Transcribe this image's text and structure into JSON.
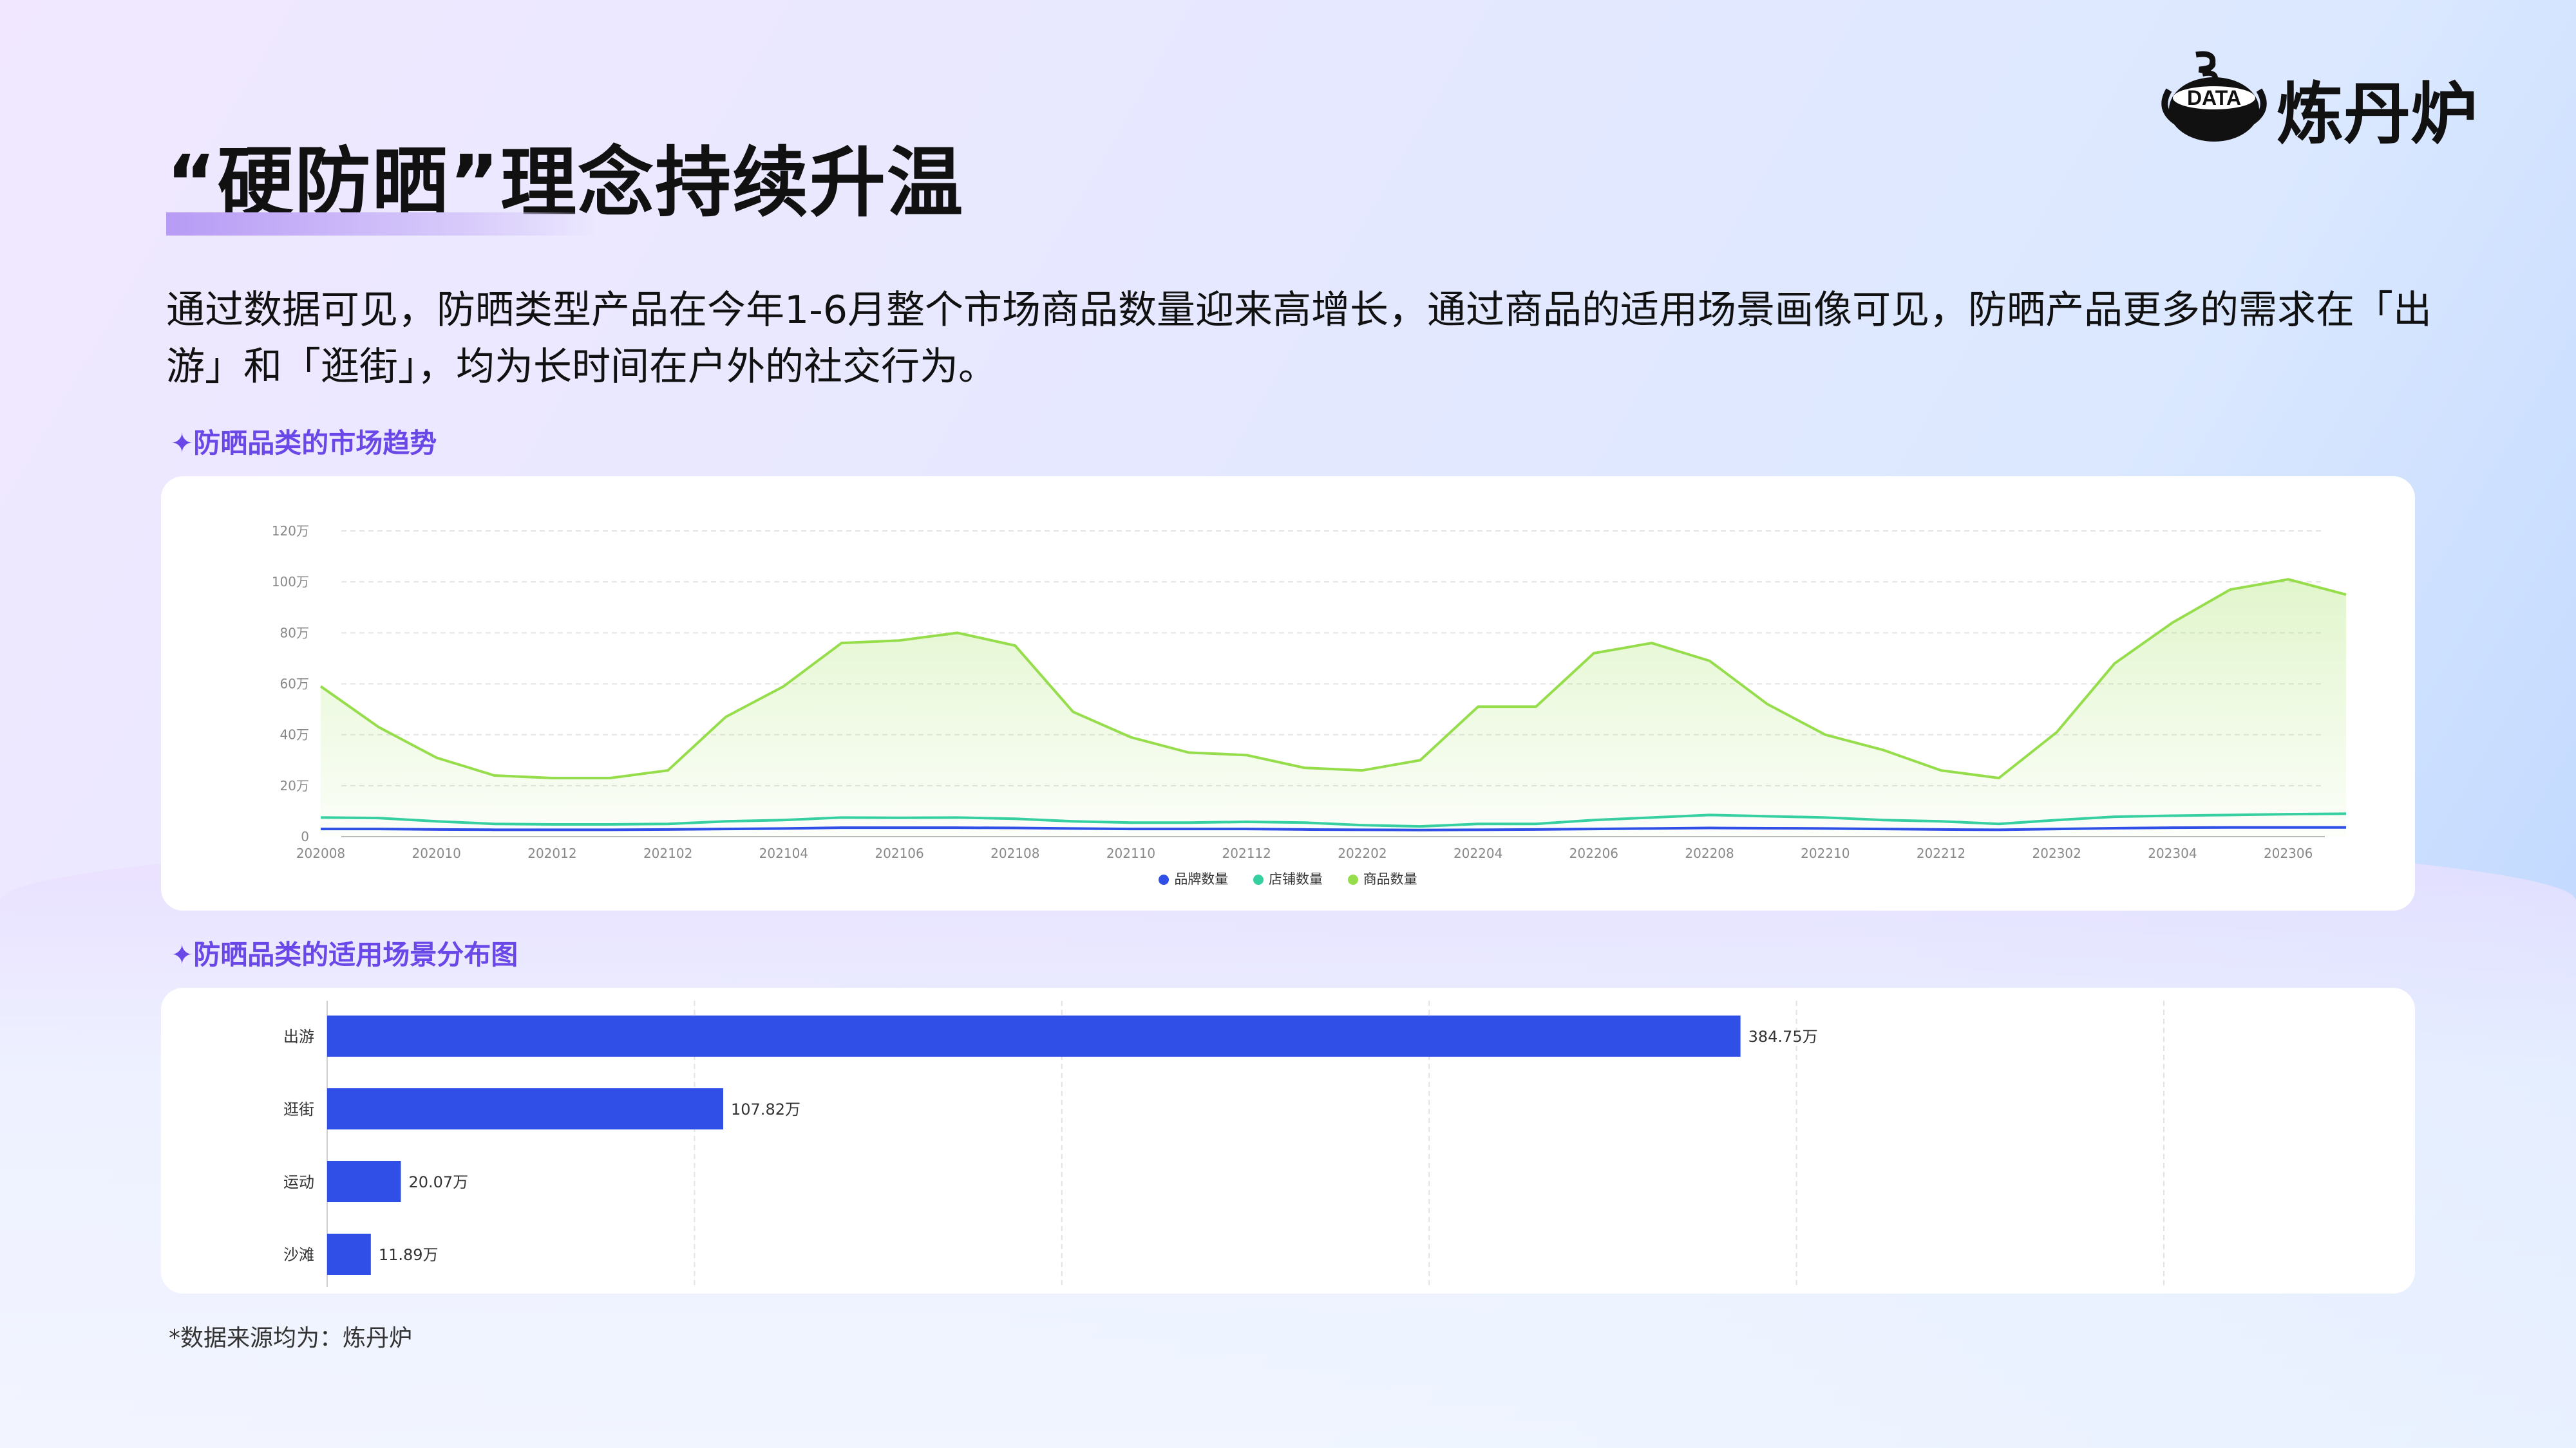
{
  "page": {
    "title": "“硬防晒”理念持续升温",
    "logo_text": "炼丹炉",
    "logo_badge": "DATA",
    "intro": "通过数据可见，防晒类型产品在今年1-6月整个市场商品数量迎来高增长，通过商品的适用场景画像可见，防晒产品更多的需求在「出游」和「逛街」，均为长时间在户外的社交行为。",
    "section1": "✦防晒品类的市场趋势",
    "section2": "✦防晒品类的适用场景分布图",
    "footnote": "*数据来源均为：炼丹炉",
    "colors": {
      "accent": "#6a48e8",
      "bar": "#2f4fe6",
      "brand_series": "#2f4fe6",
      "shop_series": "#36cfa0",
      "goods_series": "#95dd4a"
    }
  },
  "chart_data": [
    {
      "type": "area",
      "title": "",
      "xlabel": "",
      "ylabel": "",
      "ylim": [
        0,
        1200000
      ],
      "y_ticks": [
        "0",
        "20万",
        "40万",
        "60万",
        "80万",
        "100万",
        "120万"
      ],
      "x_tick_labels": [
        "202008",
        "202010",
        "202012",
        "202102",
        "202104",
        "202106",
        "202108",
        "202110",
        "202112",
        "202202",
        "202204",
        "202206",
        "202208",
        "202210",
        "202212",
        "202302",
        "202304",
        "202306"
      ],
      "x": [
        "202008",
        "202009",
        "202010",
        "202011",
        "202012",
        "202101",
        "202102",
        "202103",
        "202104",
        "202105",
        "202106",
        "202107",
        "202108",
        "202109",
        "202110",
        "202111",
        "202112",
        "202201",
        "202202",
        "202203",
        "202204",
        "202205",
        "202206",
        "202207",
        "202208",
        "202209",
        "202210",
        "202211",
        "202212",
        "202301",
        "202302",
        "202303",
        "202304",
        "202305",
        "202306",
        "202307"
      ],
      "grid": true,
      "legend_position": "bottom",
      "series": [
        {
          "name": "品牌数量",
          "color": "#2f4fe6",
          "values": [
            30000,
            30000,
            28000,
            27000,
            27000,
            27000,
            28000,
            30000,
            32000,
            35000,
            35000,
            35000,
            34000,
            32000,
            30000,
            30000,
            30000,
            28000,
            27000,
            26000,
            27000,
            28000,
            30000,
            32000,
            34000,
            33000,
            32000,
            30000,
            28000,
            27000,
            30000,
            33000,
            35000,
            36000,
            36000,
            36000
          ]
        },
        {
          "name": "店铺数量",
          "color": "#36cfa0",
          "values": [
            75000,
            73000,
            60000,
            50000,
            48000,
            48000,
            50000,
            60000,
            65000,
            75000,
            74000,
            75000,
            70000,
            60000,
            55000,
            55000,
            58000,
            55000,
            45000,
            40000,
            50000,
            50000,
            65000,
            75000,
            85000,
            80000,
            75000,
            65000,
            60000,
            50000,
            65000,
            78000,
            82000,
            85000,
            88000,
            90000
          ]
        },
        {
          "name": "商品数量",
          "color": "#95dd4a",
          "values": [
            590000,
            430000,
            310000,
            240000,
            230000,
            230000,
            260000,
            470000,
            590000,
            760000,
            770000,
            800000,
            750000,
            490000,
            390000,
            330000,
            320000,
            270000,
            260000,
            300000,
            510000,
            510000,
            720000,
            760000,
            690000,
            520000,
            400000,
            340000,
            260000,
            230000,
            410000,
            680000,
            840000,
            970000,
            1010000,
            950000
          ]
        }
      ]
    },
    {
      "type": "bar",
      "orientation": "horizontal",
      "categories": [
        "出游",
        "逛街",
        "运动",
        "沙滩"
      ],
      "values": [
        384.75,
        107.82,
        20.07,
        11.89
      ],
      "value_labels": [
        "384.75万",
        "107.82万",
        "20.07万",
        "11.89万"
      ],
      "unit": "万",
      "xlim": [
        0,
        500
      ],
      "grid": true
    }
  ]
}
